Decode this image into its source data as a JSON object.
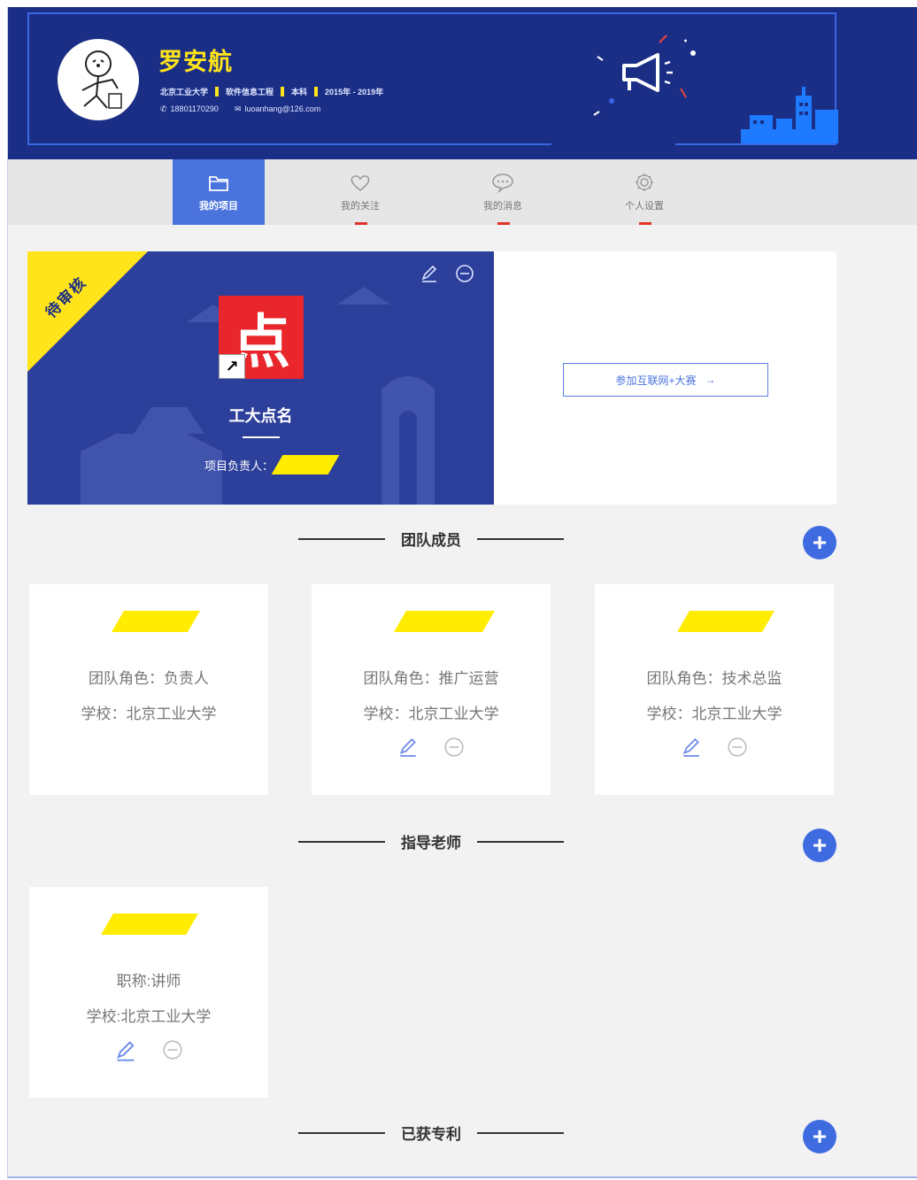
{
  "colors": {
    "header_bg": "#1b2e86",
    "accent": "#4a73de",
    "highlight": "#ffe41a",
    "logo_red": "#e8262c"
  },
  "header": {
    "name": "罗安航",
    "school": "北京工业大学",
    "major": "软件信息工程",
    "degree": "本科",
    "years": "2015年 - 2019年",
    "phone": "18801170290",
    "email": "luoanhang@126.com"
  },
  "tabs": [
    {
      "label": "我的项目",
      "icon": "folder-icon",
      "active": true
    },
    {
      "label": "我的关注",
      "icon": "heart-icon",
      "active": false
    },
    {
      "label": "我的消息",
      "icon": "message-icon",
      "active": false
    },
    {
      "label": "个人设置",
      "icon": "gear-icon",
      "active": false
    }
  ],
  "project": {
    "status": "待审核",
    "logo_char": "点",
    "name": "工大点名",
    "owner_label": "项目负责人：",
    "join_label": "参加互联网+大赛",
    "join_arrow": "→"
  },
  "sections": {
    "team": "团队成员",
    "advisor": "指导老师",
    "patent": "已获专利"
  },
  "members": [
    {
      "role": "团队角色：负责人",
      "school": "学校：北京工业大学",
      "editable": false
    },
    {
      "role": "团队角色：推广运营",
      "school": "学校：北京工业大学",
      "editable": true
    },
    {
      "role": "团队角色：技术总监",
      "school": "学校：北京工业大学",
      "editable": true
    }
  ],
  "advisors": [
    {
      "title": "职称:讲师",
      "school": "学校:北京工业大学"
    }
  ],
  "add_symbol": "+"
}
